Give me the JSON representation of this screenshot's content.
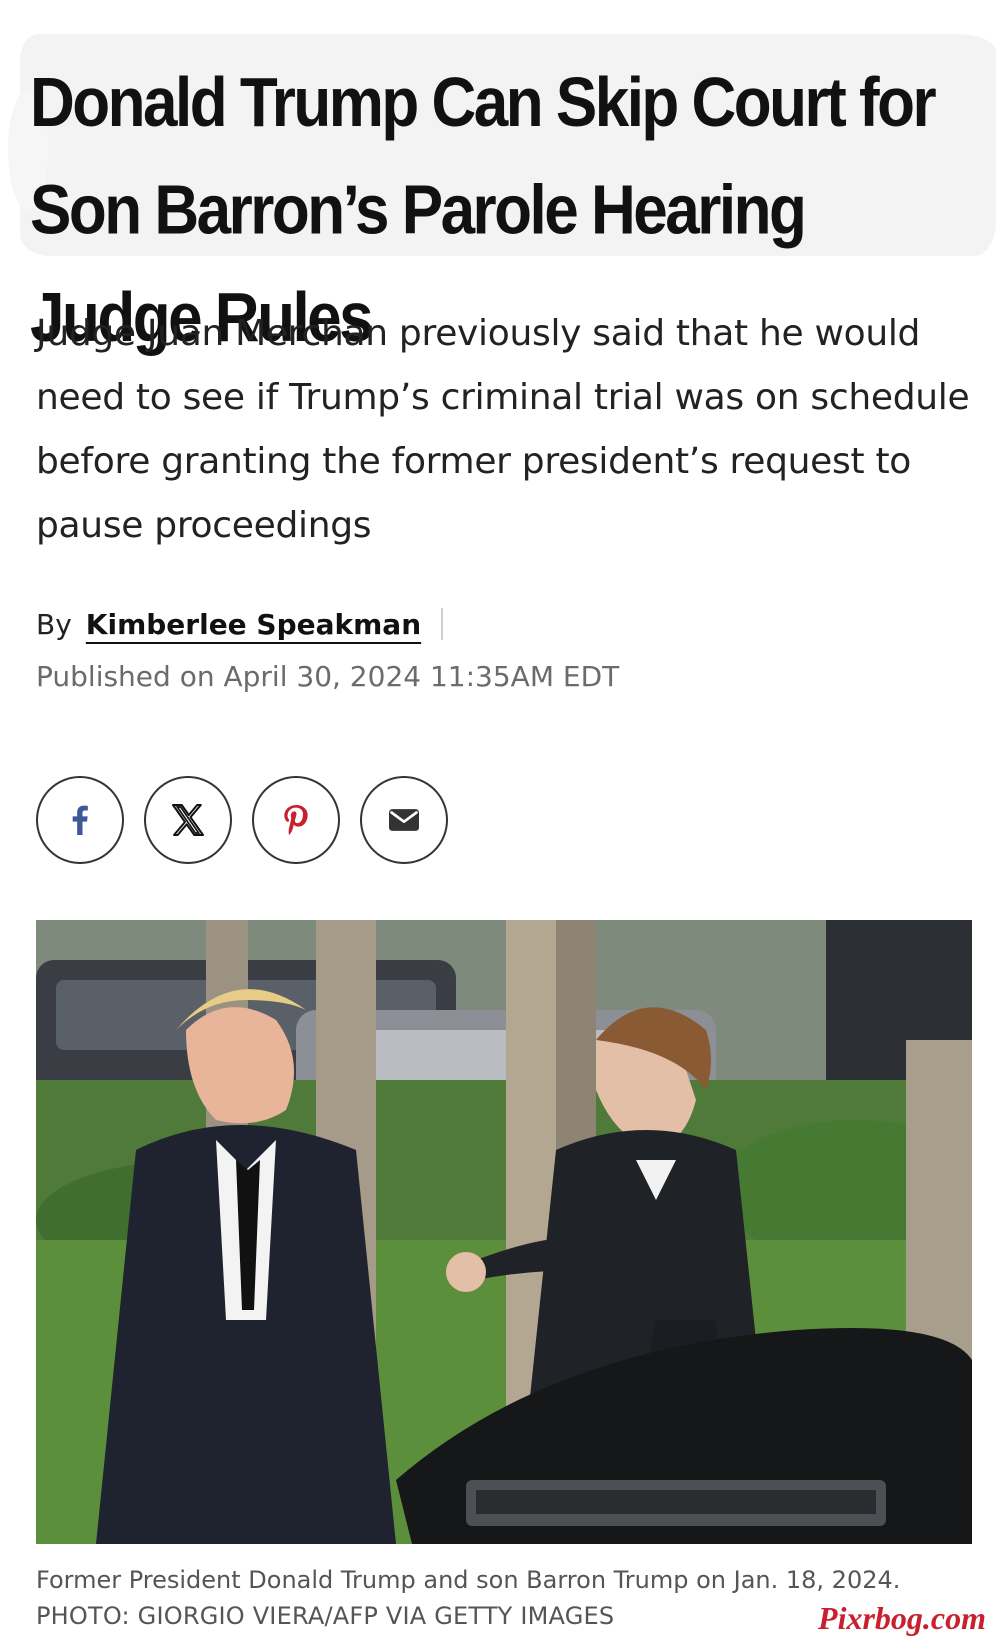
{
  "article": {
    "headline": "Donald Trump Can Skip Court for Son Barron’s Parole Hearing Judge Rules",
    "dek": "Judge Juan Merchan previously said that he would need to see if Trump’s criminal trial was on schedule before granting the former president’s request to pause proceedings",
    "byline_prefix": "By",
    "author": "Kimberlee Speakman",
    "published": "Published on April 30, 2024 11:35AM EDT"
  },
  "share": {
    "buttons": [
      {
        "icon": "facebook-icon",
        "color": "#3b5998"
      },
      {
        "icon": "x-icon",
        "color": "#111111"
      },
      {
        "icon": "pinterest-icon",
        "color": "#c8202f"
      },
      {
        "icon": "email-icon",
        "color": "#333333"
      }
    ]
  },
  "photo": {
    "caption": "Former President Donald Trump and son Barron Trump on Jan. 18, 2024.",
    "credit": "PHOTO: GIORGIO VIERA/AFP VIA GETTY IMAGES"
  },
  "watermark": "Pixrbog.com"
}
